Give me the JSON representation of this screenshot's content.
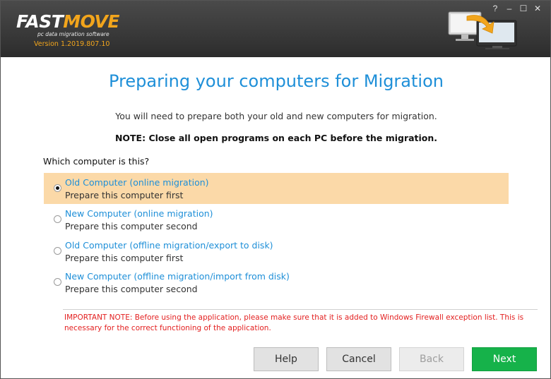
{
  "app": {
    "logo_part1": "FAST",
    "logo_part2": "MOVE",
    "tagline": "pc data migration software",
    "version": "Version 1.2019.807.10"
  },
  "window_controls": {
    "help": "?",
    "minimize": "–",
    "maximize": "☐",
    "close": "✕"
  },
  "page": {
    "title": "Preparing your computers for Migration",
    "subtitle": "You will need to prepare both your old and new computers for migration.",
    "note": "NOTE: Close all open programs on each PC before the migration.",
    "question": "Which computer is this?"
  },
  "options": [
    {
      "title": "Old Computer (online migration)",
      "desc": "Prepare this computer first",
      "selected": true
    },
    {
      "title": "New Computer (online migration)",
      "desc": "Prepare this computer second",
      "selected": false
    },
    {
      "title": "Old Computer (offline migration/export to disk)",
      "desc": "Prepare this computer first",
      "selected": false
    },
    {
      "title": "New Computer (offline migration/import from disk)",
      "desc": "Prepare this computer second",
      "selected": false
    }
  ],
  "warning": "IMPORTANT NOTE: Before using the application, please make sure that it is added to Windows Firewall exception list. This is necessary for the correct functioning of the application.",
  "buttons": {
    "help": "Help",
    "cancel": "Cancel",
    "back": "Back",
    "next": "Next"
  },
  "colors": {
    "accent_blue": "#1e8fd8",
    "brand_orange": "#f2a51c",
    "selected_row": "#fbd9a8",
    "warning_red": "#e32020",
    "next_green": "#16b24a"
  }
}
